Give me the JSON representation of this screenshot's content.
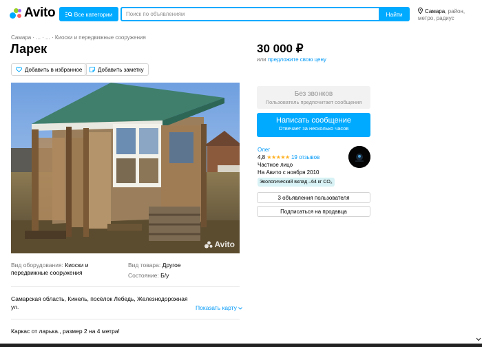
{
  "header": {
    "logo_text": "Avito",
    "categories_label": "Все категории",
    "search_placeholder": "Поиск по объявлениям",
    "search_button": "Найти",
    "location_city": "Самара",
    "location_rest": ", район, метро, радиус"
  },
  "breadcrumb": "Самара · ... · ... · Киоски и передвижные сооружения",
  "title": "Ларек",
  "actions": {
    "favorite": "Добавить в избранное",
    "note": "Добавить заметку"
  },
  "photo": {
    "watermark": "Avito"
  },
  "properties": [
    {
      "label": "Вид оборудования: ",
      "value": "Киоски и передвижные сооружения"
    },
    {
      "label": "Вид товара: ",
      "value": "Другое"
    },
    {
      "label": "Состояние: ",
      "value": "Б/у"
    }
  ],
  "address": "Самарская область, Кинель, посёлок Лебедь, Железнодорожная ул.",
  "map_link": "Показать карту",
  "description": "Каркас от ларька., размер 2 на 4 метра!",
  "price": {
    "value": "30 000 ₽",
    "or_label": "или ",
    "offer_link": "предложите свою цену"
  },
  "no_calls": {
    "title": "Без звонков",
    "subtitle": "Пользователь предпочитает сообщения"
  },
  "message_button": {
    "title": "Написать сообщение",
    "subtitle": "Отвечает за несколько часов"
  },
  "seller": {
    "name": "Олег",
    "rating": "4,8",
    "stars": "★★★★★",
    "reviews": "19 отзывов",
    "type": "Частное лицо",
    "since": "На Авито с ноября 2010",
    "eco_badge": "Экологический вклад –64 кг CO₂"
  },
  "seller_buttons": {
    "listings": "3 объявления пользователя",
    "subscribe": "Подписаться на продавца"
  },
  "colors": {
    "accent": "#00aaff",
    "link": "#0099f7",
    "star": "#ffb021"
  }
}
